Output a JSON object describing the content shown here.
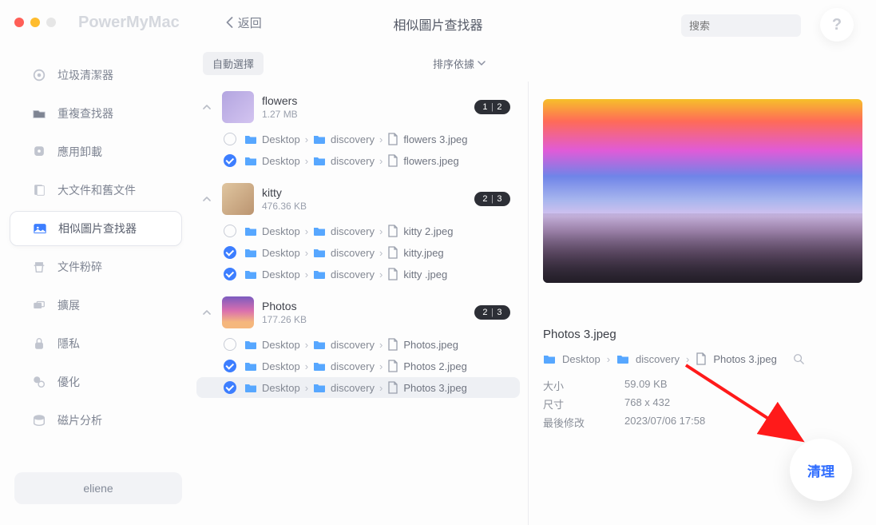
{
  "appTitle": "PowerMyMac",
  "backLabel": "返回",
  "pageTitle": "相似圖片查找器",
  "search": {
    "placeholder": "搜索"
  },
  "helpGlyph": "?",
  "sidebar": {
    "items": [
      {
        "label": "垃圾清潔器"
      },
      {
        "label": "重複查找器"
      },
      {
        "label": "應用卸載"
      },
      {
        "label": "大文件和舊文件"
      },
      {
        "label": "相似圖片查找器"
      },
      {
        "label": "文件粉碎"
      },
      {
        "label": "擴展"
      },
      {
        "label": "隱私"
      },
      {
        "label": "優化"
      },
      {
        "label": "磁片分析"
      }
    ],
    "activeIndex": 4
  },
  "user": "eliene",
  "toolbar": {
    "autoSelect": "自動選擇",
    "sort": "排序依據"
  },
  "groups": [
    {
      "name": "flowers",
      "size": "1.27 MB",
      "badge": {
        "selected": "1",
        "total": "2"
      },
      "files": [
        {
          "checked": false,
          "segments": [
            "Desktop",
            "discovery"
          ],
          "file": "flowers 3.jpeg"
        },
        {
          "checked": true,
          "segments": [
            "Desktop",
            "discovery"
          ],
          "file": "flowers.jpeg"
        }
      ]
    },
    {
      "name": "kitty",
      "size": "476.36 KB",
      "badge": {
        "selected": "2",
        "total": "3"
      },
      "files": [
        {
          "checked": false,
          "segments": [
            "Desktop",
            "discovery"
          ],
          "file": "kitty 2.jpeg"
        },
        {
          "checked": true,
          "segments": [
            "Desktop",
            "discovery"
          ],
          "file": "kitty.jpeg"
        },
        {
          "checked": true,
          "segments": [
            "Desktop",
            "discovery"
          ],
          "file": "kitty .jpeg"
        }
      ]
    },
    {
      "name": "Photos",
      "size": "177.26 KB",
      "badge": {
        "selected": "2",
        "total": "3"
      },
      "files": [
        {
          "checked": false,
          "segments": [
            "Desktop",
            "discovery"
          ],
          "file": "Photos.jpeg"
        },
        {
          "checked": true,
          "segments": [
            "Desktop",
            "discovery"
          ],
          "file": "Photos 2.jpeg"
        },
        {
          "checked": true,
          "segments": [
            "Desktop",
            "discovery"
          ],
          "file": "Photos 3.jpeg",
          "selected": true
        }
      ]
    }
  ],
  "preview": {
    "title": "Photos 3.jpeg",
    "crumbs": [
      "Desktop",
      "discovery"
    ],
    "file": "Photos 3.jpeg",
    "details": [
      {
        "k": "大小",
        "v": "59.09 KB"
      },
      {
        "k": "尺寸",
        "v": "768 x 432"
      },
      {
        "k": "最後修改",
        "v": "2023/07/06 17:58"
      }
    ]
  },
  "cleanButton": "清理",
  "colors": {
    "accent": "#3d7eff",
    "annotation": "#ff1a1a"
  }
}
